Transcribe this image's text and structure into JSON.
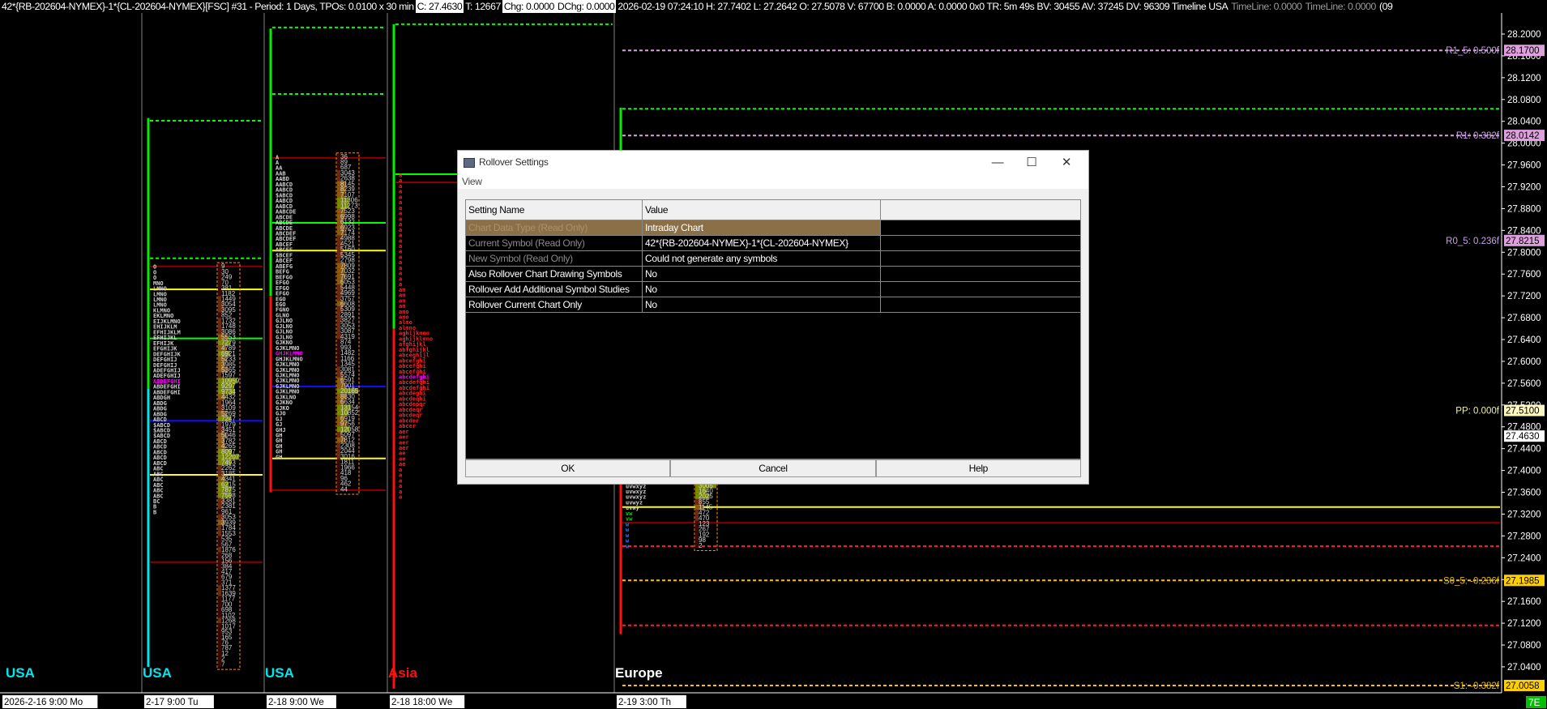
{
  "header": {
    "symbol_info": "42*{RB-202604-NYMEX}-1*{CL-202604-NYMEX}[FSC] #31 - Period: 1 Days, TPOs: 0.0100 x 30 min",
    "close": "C: 27.4630",
    "ticks": "T: 12667",
    "chg": "Chg: 0.0000",
    "dchg": "DChg: 0.0000",
    "stats": "2026-02-19 07:24:10 H: 27.7402 L: 27.2642 O: 27.5078 V: 67700 B: 0.0000 A: 0.0000 0x0 TR: 5m 49s BV: 30455 AV: 37245 DV: 96309 Timeline USA",
    "timeline1": "TimeLine: 0.0000",
    "timeline2": "TimeLine: 0.0000",
    "tail": "(09"
  },
  "dialog": {
    "title": "Rollover Settings",
    "menu_view": "View",
    "minimize": "—",
    "maximize": "☐",
    "close": "✕",
    "columns": [
      "Setting Name",
      "Value",
      ""
    ],
    "rows": [
      {
        "name": "Chart Data Type (Read Only)",
        "value": "Intraday Chart"
      },
      {
        "name": "Current Symbol (Read Only)",
        "value": "42*{RB-202604-NYMEX}-1*{CL-202604-NYMEX}"
      },
      {
        "name": "New Symbol (Read Only)",
        "value": "Could not generate any symbols"
      },
      {
        "name": "Also Rollover Chart Drawing Symbols",
        "value": "No"
      },
      {
        "name": "Rollover Add Additional Symbol Studies",
        "value": "No"
      },
      {
        "name": "Rollover Current Chart Only",
        "value": "No"
      }
    ],
    "ok": "OK",
    "cancel": "Cancel",
    "help": "Help"
  },
  "chart_data": {
    "type": "tpo-profile",
    "price_axis": {
      "max": 28.2,
      "min": 27.0,
      "step": 0.04,
      "ticks": [
        "28.2000",
        "28.1600",
        "28.1200",
        "28.0800",
        "28.0400",
        "28.0000",
        "27.9600",
        "27.9200",
        "27.8800",
        "27.8400",
        "27.8000",
        "27.7600",
        "27.7200",
        "27.6800",
        "27.6400",
        "27.6000",
        "27.5600",
        "27.5200",
        "27.4800",
        "27.4400",
        "27.4000",
        "27.3600",
        "27.3200",
        "27.2800",
        "27.2400",
        "27.2000",
        "27.1600",
        "27.1200",
        "27.0800",
        "27.0400"
      ]
    },
    "levels": [
      {
        "label": "R1_5: 0.500f",
        "value": "28.1700",
        "price": 28.17,
        "color": "#c8a0e8",
        "bg": "#dda0dd"
      },
      {
        "label": "R1: 0.382f",
        "value": "28.0142",
        "price": 28.0142,
        "color": "#c8a0e8",
        "bg": "#dda0dd"
      },
      {
        "label": "R0_5: 0.236f",
        "value": "27.8215",
        "price": 27.8215,
        "color": "#c8a0e8",
        "bg": "#dda0dd"
      },
      {
        "label": "PP: 0.000f",
        "value": "27.5100",
        "price": 27.51,
        "color": "#f0f0a0",
        "bg": "#fff8c0"
      },
      {
        "label": "",
        "value": "27.4630",
        "price": 27.463,
        "color": "#ffffff",
        "bg": "#ffffff"
      },
      {
        "label": "S0_5: -0.236f",
        "value": "27.1985",
        "price": 27.1985,
        "color": "#e0b800",
        "bg": "#ffd000"
      },
      {
        "label": "S1: -0.382f",
        "value": "27.0058",
        "price": 27.0058,
        "color": "#e0b800",
        "bg": "#ffd000"
      }
    ],
    "sessions": [
      {
        "name": "USA",
        "color": "#00e5ee",
        "time": "2026-2-16  9:00 Mo"
      },
      {
        "name": "USA",
        "color": "#00e5ee",
        "time": "2-17  9:00 Tu"
      },
      {
        "name": "USA",
        "color": "#00e5ee",
        "time": "2-18  9:00 We"
      },
      {
        "name": "Asia",
        "color": "#ff1010",
        "time": "2-18  18:00 We"
      },
      {
        "name": "Europe",
        "color": "#ffffff",
        "time": "2-19  3:00 Th"
      }
    ],
    "corner_badge": "7E",
    "profiles": [
      {
        "session": 1,
        "top": 27.778,
        "high": 28.046,
        "low": 27.04,
        "bar_split": 27.55,
        "rows": [
          "O",
          "O",
          "O",
          "MNO",
          "LMNO",
          "LMNO",
          "LMNO",
          "LMNO",
          "KLMNO",
          "EKLMNO",
          "EIJKLMNO",
          "EHIJKLM",
          "EFHIJKLM",
          "EFHIJKL",
          "EFHIJK",
          "EFGHIJK",
          "DEFGHIJK",
          "DEFGHIJ",
          "DEFGHIJ",
          "ADEFGHIJ",
          "ADEFGHIJ",
          "ABDEFGHI",
          "ABDEFGHI",
          "ABDEFGHI",
          "ABDGH",
          "ABDG",
          "ABDG",
          "ABDG",
          "ABCD",
          "$ABCD",
          "$ABCD",
          "$ABCD",
          "ABCD",
          "ABCD",
          "ABCD",
          "ABCD",
          "ABCD",
          "ABC",
          "ABC",
          "ABC",
          "ABC",
          "ABC",
          "ABC",
          "BC",
          "B",
          "B"
        ],
        "poc_row": 21,
        "vol_top": 27.778,
        "volumes": [
          "9",
          "30",
          "249",
          "70",
          "381",
          "1182",
          "1449",
          "3054",
          "3095",
          "852",
          "1732",
          "1748",
          "3086",
          "5553",
          "7279",
          "4789",
          "6921",
          "5233",
          "3985",
          "5365",
          "1597",
          "10959",
          "9297",
          "9734",
          "4432",
          "1964",
          "3109",
          "5269",
          "7247",
          "1979",
          "3451",
          "5046",
          "3782",
          "4265",
          "8097",
          "12207",
          "7493",
          "2262",
          "3185",
          "4341",
          "6215",
          "7875",
          "7598",
          "3381",
          "2381",
          "961",
          "3053",
          "3939",
          "1784",
          "1553",
          "535",
          "567",
          "1876",
          "268",
          "156",
          "384",
          "417",
          "679",
          "371",
          "1377",
          "1639",
          "1177",
          "700",
          "698",
          "1102",
          "1268",
          "1017",
          "953",
          "165",
          "76",
          "787",
          "12",
          "2",
          "7"
        ]
      },
      {
        "session": 2,
        "top": 27.979,
        "high": 28.21,
        "low": 27.36,
        "bar_split": 27.72,
        "rows": [
          "A",
          "A",
          "AA",
          "AAB",
          "AABD",
          "AABCD",
          "AABCD",
          "$ABCD",
          "AABCD",
          "AABCD",
          "AABCDE",
          "ABCDE",
          "ABCDE",
          "ABCDE",
          "ABCDEF",
          "ABCDEF",
          "ABCEF",
          "ABCEF",
          "$BCEF",
          "ABCEF",
          "ABEFG",
          "BEFG",
          "BEFGO",
          "EFGO",
          "EFGO",
          "EFGO",
          "EGO",
          "EGO",
          "FGNO",
          "GLNO",
          "GJLNO",
          "GJLNO",
          "GJLNO",
          "GJLNO",
          "GJKNO",
          "GJKLMNO",
          "GHJKLMNO",
          "GHJKLMNO",
          "GJKLMNO",
          "GJKLMNO",
          "GJKLMNO",
          "GJKLMNO",
          "GJKLMNO",
          "GJKLMNO",
          "GJKLNO",
          "GJKNO",
          "GJKO",
          "GJO",
          "GJ",
          "GJ",
          "GHJ",
          "GH",
          "GH",
          "GH",
          "GH",
          "GH"
        ],
        "poc_row": 36,
        "vol_top": 27.979,
        "volumes": [
          "36",
          "89",
          "687",
          "3043",
          "2638",
          "8145",
          "8239",
          "7107",
          "11306",
          "11273",
          "7523",
          "6998",
          "6132",
          "6923",
          "7174",
          "4988",
          "4521",
          "5160",
          "5345",
          "2798",
          "7809",
          "7032",
          "7691",
          "6053",
          "5448",
          "4969",
          "3757",
          "6608",
          "5309",
          "2891",
          "3827",
          "3053",
          "3087",
          "4319",
          "874",
          "993",
          "1482",
          "1166",
          "1345",
          "3081",
          "5574",
          "6591",
          "7901",
          "20165",
          "8830",
          "6634",
          "13154",
          "10852",
          "6919",
          "9756",
          "12058",
          "5097",
          "7812",
          "2308",
          "2044",
          "3016",
          "1811",
          "1966",
          "418",
          "96",
          "462",
          "44"
        ]
      },
      {
        "session": 3,
        "top": 27.946,
        "high": 28.218,
        "low": 27.0,
        "bar_split": 27.66,
        "rows": [
          "a",
          "a",
          "a",
          "a",
          "a",
          "a",
          "a",
          "a",
          "a",
          "a",
          "a",
          "a",
          "a",
          "a",
          "a",
          "a",
          "a",
          "a",
          "a",
          "a",
          "a",
          "am",
          "am",
          "am",
          "am",
          "amo",
          "amo",
          "almo",
          "almno",
          "aghijkmno",
          "aghijklmno",
          "afghijkl",
          "abfghijkl",
          "abceghijl",
          "abcefghi",
          "abcefghi",
          "abcefghi",
          "abcdefghi",
          "abcdefghi",
          "abcdefghi",
          "abcdeghi",
          "abcdeqhi",
          "abcdepqr",
          "abcdeqr",
          "abcdeqr",
          "abcder",
          "abcer",
          "aer",
          "aer",
          "aer",
          "aer",
          "ae",
          "ae",
          "ae",
          "a",
          "a",
          "a",
          "a",
          "a",
          "a"
        ],
        "poc_row": 37,
        "vol_top": 27.946,
        "volumes": []
      },
      {
        "session": 4,
        "top": 27.376,
        "high": 28.065,
        "low": 27.1,
        "bar_split": 27.95,
        "rows": [
          "uvwxyz",
          "uvwxyz",
          "uvwxyz",
          "uvwyz",
          "uvwy",
          "vw",
          "vw",
          "w",
          "w",
          "w",
          "w",
          "w"
        ],
        "poc_row": -1,
        "vol_top": 27.376,
        "volumes": [
          "3005",
          "1640",
          "2025",
          "855",
          "1145",
          "472",
          "470",
          "123",
          "267",
          "192",
          "98",
          "2"
        ]
      }
    ],
    "lines": [
      {
        "session": 1,
        "price": 28.041,
        "color": "#00ff00",
        "dash": true
      },
      {
        "session": 1,
        "price": 27.789,
        "color": "#00ff00",
        "dash": true
      },
      {
        "session": 1,
        "price": 27.774,
        "color": "#8b0000",
        "dash": false
      },
      {
        "session": 1,
        "price": 27.732,
        "color": "#ffff00",
        "dash": false
      },
      {
        "session": 1,
        "price": 27.642,
        "color": "#00ff00",
        "dash": false
      },
      {
        "session": 1,
        "price": 27.491,
        "color": "#1010ff",
        "dash": false
      },
      {
        "session": 1,
        "price": 27.392,
        "color": "#ffff00",
        "dash": false
      },
      {
        "session": 1,
        "price": 27.232,
        "color": "#8b0000",
        "dash": false
      },
      {
        "session": 2,
        "price": 28.212,
        "color": "#00ff00",
        "dash": true
      },
      {
        "session": 2,
        "price": 28.09,
        "color": "#00ff00",
        "dash": true
      },
      {
        "session": 2,
        "price": 27.973,
        "color": "#8b0000",
        "dash": false
      },
      {
        "session": 2,
        "price": 27.854,
        "color": "#00ff00",
        "dash": false
      },
      {
        "session": 2,
        "price": 27.803,
        "color": "#ffff00",
        "dash": false
      },
      {
        "session": 2,
        "price": 27.554,
        "color": "#1010ff",
        "dash": false
      },
      {
        "session": 2,
        "price": 27.422,
        "color": "#ffff00",
        "dash": false
      },
      {
        "session": 2,
        "price": 27.364,
        "color": "#8b0000",
        "dash": false
      },
      {
        "session": 3,
        "price": 28.218,
        "color": "#00ff00",
        "dash": true
      },
      {
        "session": 3,
        "price": 27.943,
        "color": "#00ff00",
        "dash": false
      },
      {
        "session": 3,
        "price": 27.928,
        "color": "#8b0000",
        "dash": false
      },
      {
        "session": 4,
        "price": 28.17,
        "color": "#dda0dd",
        "dash": true
      },
      {
        "session": 4,
        "price": 28.063,
        "color": "#00ff00",
        "dash": true
      },
      {
        "session": 4,
        "price": 28.014,
        "color": "#dda0dd",
        "dash": true
      },
      {
        "session": 4,
        "price": 27.333,
        "color": "#ffff00",
        "dash": false
      },
      {
        "session": 4,
        "price": 27.304,
        "color": "#8b0000",
        "dash": false
      },
      {
        "session": 4,
        "price": 27.261,
        "color": "#ff2020",
        "dash": true
      },
      {
        "session": 4,
        "price": 27.1985,
        "color": "#ffc000",
        "dash": true
      },
      {
        "session": 4,
        "price": 27.116,
        "color": "#ff2020",
        "dash": true
      },
      {
        "session": 4,
        "price": 27.0058,
        "color": "#ffc000",
        "dash": true
      }
    ]
  }
}
